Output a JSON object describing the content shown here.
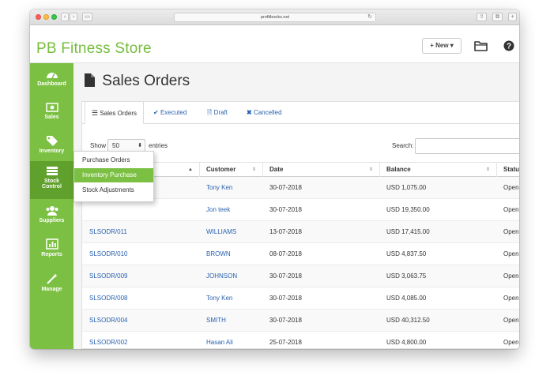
{
  "browser": {
    "url": "profitbooks.net"
  },
  "app": {
    "brand": "PB Fitness Store",
    "new_label": "+ New ▾"
  },
  "header_icons": {
    "folder": "folder-icon",
    "help": "help-icon"
  },
  "colors": {
    "accent": "#7cc043",
    "accent_dark": "#60a12d",
    "link": "#2a62b0"
  },
  "sidebar": {
    "items": [
      {
        "label": "Dashboard",
        "icon": "dashboard-icon"
      },
      {
        "label": "Sales",
        "icon": "money-icon"
      },
      {
        "label": "Inventory",
        "icon": "tag-icon"
      },
      {
        "label": "Stock",
        "label2": "Control",
        "icon": "stock-icon"
      },
      {
        "label": "Suppliers",
        "icon": "users-icon"
      },
      {
        "label": "Reports",
        "icon": "chart-icon"
      },
      {
        "label": "Manage",
        "icon": "wand-icon"
      }
    ]
  },
  "dropdown": {
    "items": [
      "Purchase Orders",
      "Inventory Purchase",
      "Stock Adjustments"
    ],
    "active_index": 1
  },
  "page": {
    "title": "Sales Orders"
  },
  "tabs": [
    {
      "label": "Sales Orders",
      "icon": "list-icon"
    },
    {
      "label": "Executed",
      "icon": "check-icon"
    },
    {
      "label": "Draft",
      "icon": "file-icon"
    },
    {
      "label": "Cancelled",
      "icon": "x-icon"
    }
  ],
  "controls": {
    "show_label": "Show",
    "page_length": "50",
    "entries_label": "entries",
    "search_label": "Search:"
  },
  "table": {
    "columns": [
      "",
      "Customer",
      "Date",
      "Balance",
      "Status"
    ],
    "rows": [
      {
        "order": "",
        "customer": "Tony Ken",
        "date": "30-07-2018",
        "balance": "USD 1,075.00",
        "status": "Open"
      },
      {
        "order": "",
        "customer": "Jon teek",
        "date": "30-07-2018",
        "balance": "USD 19,350.00",
        "status": "Open"
      },
      {
        "order": "SLSODR/011",
        "customer": "WILLIAMS",
        "date": "13-07-2018",
        "balance": "USD 17,415.00",
        "status": "Open"
      },
      {
        "order": "SLSODR/010",
        "customer": "BROWN",
        "date": "08-07-2018",
        "balance": "USD 4,837.50",
        "status": "Open"
      },
      {
        "order": "SLSODR/009",
        "customer": "JOHNSON",
        "date": "30-07-2018",
        "balance": "USD 3,063.75",
        "status": "Open"
      },
      {
        "order": "SLSODR/008",
        "customer": "Tony Ken",
        "date": "30-07-2018",
        "balance": "USD 4,085.00",
        "status": "Open"
      },
      {
        "order": "SLSODR/004",
        "customer": "SMITH",
        "date": "30-07-2018",
        "balance": "USD 40,312.50",
        "status": "Open"
      },
      {
        "order": "SLSODR/002",
        "customer": "Hasan Ali",
        "date": "25-07-2018",
        "balance": "USD 4,800.00",
        "status": "Open"
      }
    ]
  }
}
